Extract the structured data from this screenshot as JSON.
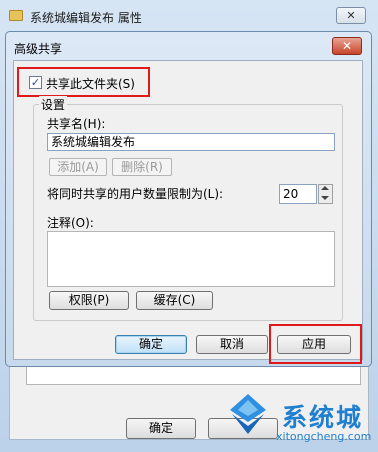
{
  "background_window": {
    "title": "系统城编辑发布 属性",
    "close_label": "✕",
    "ok_label": "确定"
  },
  "dialog": {
    "title": "高级共享",
    "close_label": "✕",
    "share_checkbox": {
      "label": "共享此文件夹(S)",
      "checked": true
    },
    "settings": {
      "group_title": "设置",
      "share_name_label": "共享名(H):",
      "share_name_value": "系统城编辑发布",
      "add_label": "添加(A)",
      "remove_label": "删除(R)",
      "limit_label": "将同时共享的用户数量限制为(L):",
      "limit_value": "20",
      "comment_label": "注释(O):",
      "permissions_label": "权限(P)",
      "caching_label": "缓存(C)"
    },
    "buttons": {
      "ok": "确定",
      "cancel": "取消",
      "apply": "应用"
    }
  },
  "colors": {
    "highlight_box": "#e0191b",
    "watermark": "#1f7fd0"
  },
  "watermark": {
    "name": "系统城",
    "url": "xitongcheng.com"
  }
}
